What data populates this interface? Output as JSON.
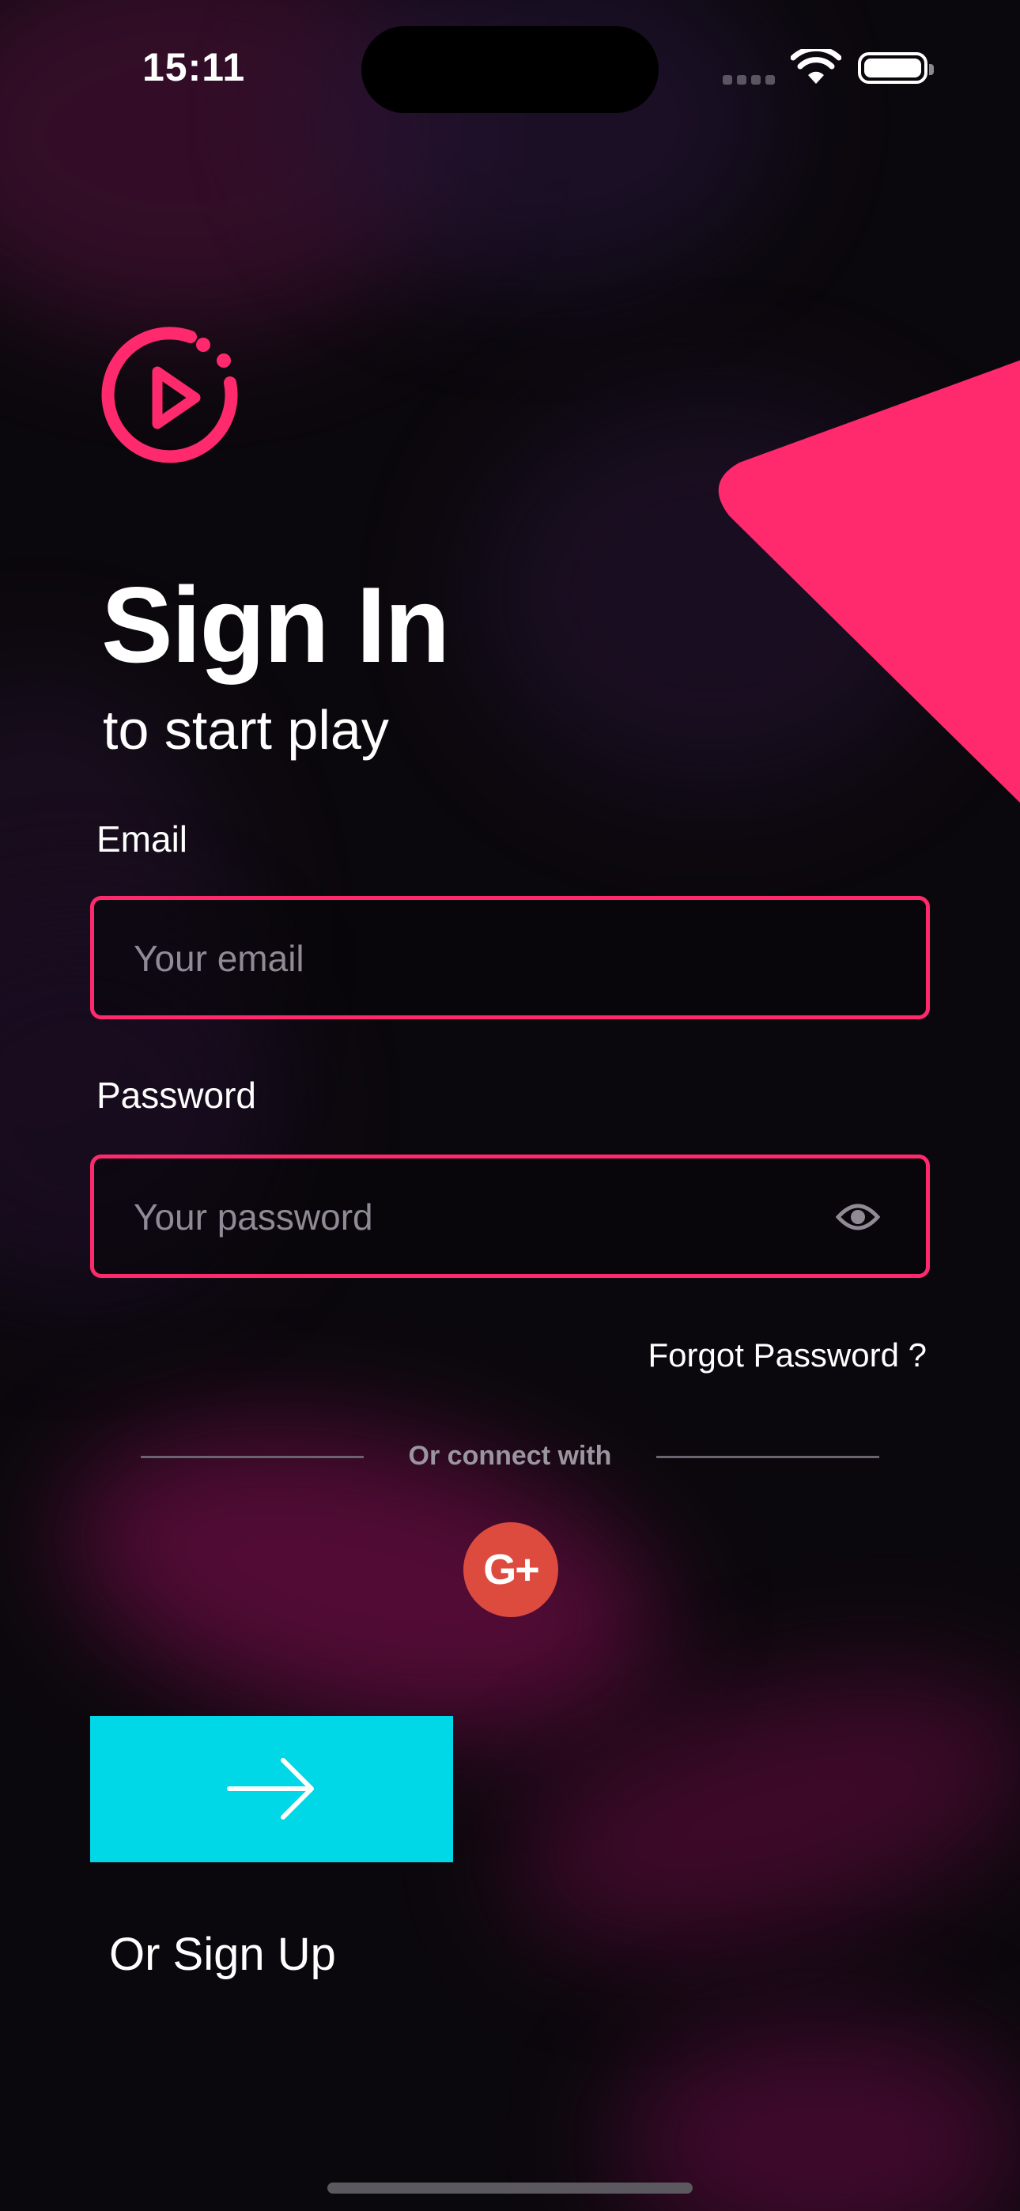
{
  "status_bar": {
    "time": "15:11"
  },
  "header": {
    "title": "Sign In",
    "subtitle": "to start play"
  },
  "form": {
    "email_label": "Email",
    "email_placeholder": "Your email",
    "email_value": "",
    "password_label": "Password",
    "password_placeholder": "Your password",
    "password_value": "",
    "forgot_label": "Forgot Password ?"
  },
  "social": {
    "divider_label": "Or connect with",
    "google_label": "G+"
  },
  "actions": {
    "submit_icon": "arrow-right-icon",
    "signup_label": "Or Sign Up"
  },
  "colors": {
    "accent": "#ff2a6d",
    "submit": "#00d8e8",
    "google": "#dd4b3e",
    "background": "#0b080d"
  }
}
